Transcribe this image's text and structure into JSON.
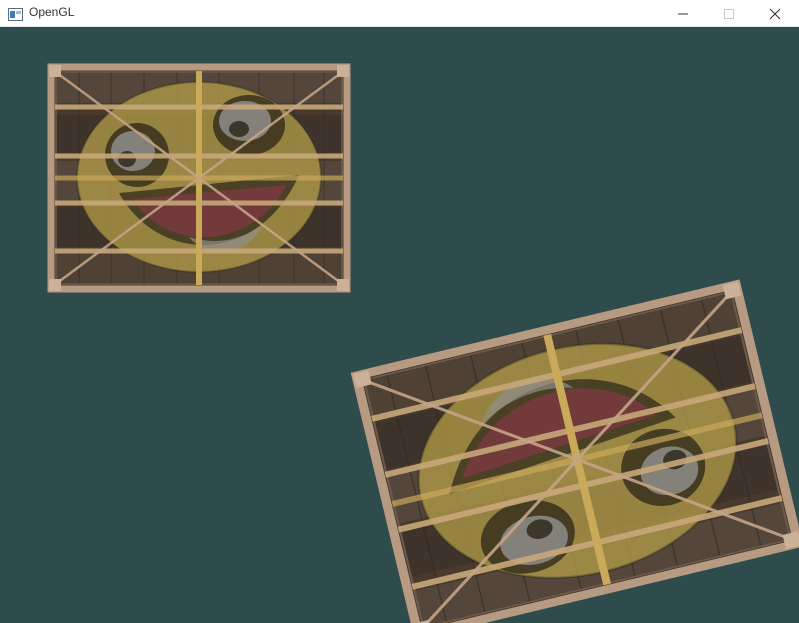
{
  "window": {
    "title": "OpenGL",
    "icons": {
      "app": "opengl-window-icon",
      "minimize": "minimize-icon",
      "maximize": "maximize-icon",
      "close": "close-icon"
    }
  },
  "colors": {
    "clear": "#2f4c4c",
    "crate_wood": "#4a3a2e",
    "crate_frame": "#b79a82",
    "face_yellow": "#b9a24a",
    "face_dark": "#2a2418",
    "eye_white": "#8f8d8a",
    "mouth_red": "#7a3a40"
  },
  "scene": {
    "objects": [
      {
        "name": "crate-quad-static",
        "texture": "container-with-awesomeface"
      },
      {
        "name": "crate-quad-rotated",
        "texture": "container-with-awesomeface"
      }
    ]
  }
}
